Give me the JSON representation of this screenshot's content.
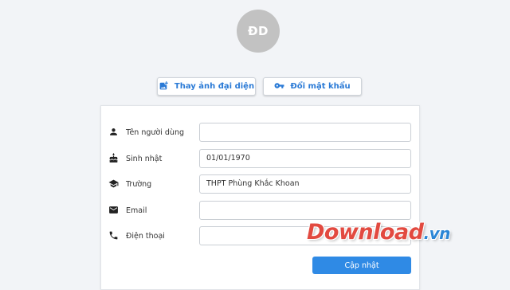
{
  "profile": {
    "avatar_initials": "ĐD"
  },
  "actions": {
    "change_avatar_label": "Thay ảnh đại diện",
    "change_password_label": "Đổi mật khẩu"
  },
  "form": {
    "fields": [
      {
        "icon": "person-icon",
        "label": "Tên người dùng",
        "value": ""
      },
      {
        "icon": "cake-icon",
        "label": "Sinh nhật",
        "value": "01/01/1970"
      },
      {
        "icon": "school-icon",
        "label": "Trường",
        "value": "THPT Phùng Khắc Khoan"
      },
      {
        "icon": "mail-icon",
        "label": "Email",
        "value": ""
      },
      {
        "icon": "phone-icon",
        "label": "Điện thoại",
        "value": ""
      }
    ],
    "submit_label": "Cập nhật"
  },
  "watermark": {
    "text": "Download",
    "suffix": ".vn"
  },
  "colors": {
    "accent": "#2f8ae5",
    "link": "#2a7ad6",
    "avatar_bg": "#c2c2c2",
    "watermark": "#e24a40"
  }
}
